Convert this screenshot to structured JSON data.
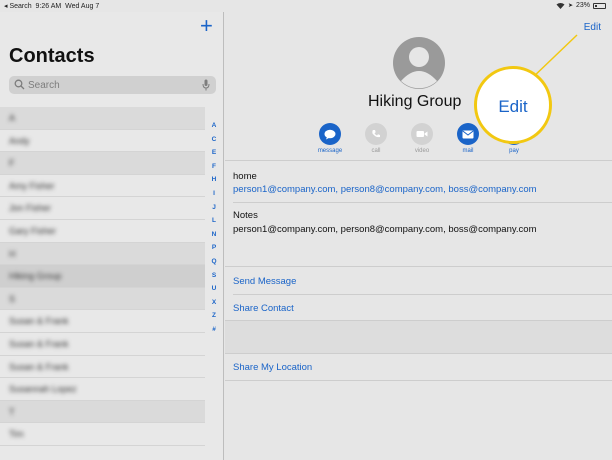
{
  "status_bar": {
    "back": "◂ Search",
    "time": "9:26 AM",
    "date": "Wed Aug 7",
    "battery": "23%",
    "battery_fraction": 0.23
  },
  "sidebar": {
    "title": "Contacts",
    "add_label": "+",
    "search_placeholder": "Search",
    "rows": [
      {
        "text": "A",
        "type": "header"
      },
      {
        "text": "Andy",
        "type": "contact"
      },
      {
        "text": "F",
        "type": "header"
      },
      {
        "text": "Amy Fisher",
        "type": "contact"
      },
      {
        "text": "Jon Fisher",
        "type": "contact"
      },
      {
        "text": "Gary Fisher",
        "type": "contact"
      },
      {
        "text": "H",
        "type": "header"
      },
      {
        "text": "Hiking Group",
        "type": "selected"
      },
      {
        "text": "S",
        "type": "header"
      },
      {
        "text": "Susan & Frank",
        "type": "contact"
      },
      {
        "text": "Susan & Frank",
        "type": "contact"
      },
      {
        "text": "Susan & Frank",
        "type": "contact"
      },
      {
        "text": "Susannah Lopez",
        "type": "contact"
      },
      {
        "text": "T",
        "type": "header"
      },
      {
        "text": "Tim",
        "type": "contact"
      }
    ],
    "index_letters": [
      "A",
      "C",
      "E",
      "F",
      "H",
      "I",
      "J",
      "L",
      "N",
      "P",
      "Q",
      "S",
      "U",
      "X",
      "Z",
      "#"
    ]
  },
  "detail": {
    "edit_label": "Edit",
    "name": "Hiking Group",
    "callout_label": "Edit",
    "actions": [
      {
        "label": "message",
        "icon": "message-icon",
        "enabled": true
      },
      {
        "label": "call",
        "icon": "phone-icon",
        "enabled": false
      },
      {
        "label": "video",
        "icon": "video-icon",
        "enabled": false
      },
      {
        "label": "mail",
        "icon": "mail-icon",
        "enabled": true
      },
      {
        "label": "pay",
        "icon": "pay-icon",
        "enabled": true
      }
    ],
    "email_label": "home",
    "email_recipients": [
      "person1@company.com",
      "person8@company.com",
      "boss@company.com"
    ],
    "notes_label": "Notes",
    "notes_text": "person1@company.com, person8@company.com, boss@company.com",
    "links": {
      "send_message": "Send Message",
      "share_contact": "Share Contact",
      "share_location": "Share My Location"
    }
  },
  "colors": {
    "accent": "#1a64c8",
    "callout_border": "#f2c811"
  }
}
